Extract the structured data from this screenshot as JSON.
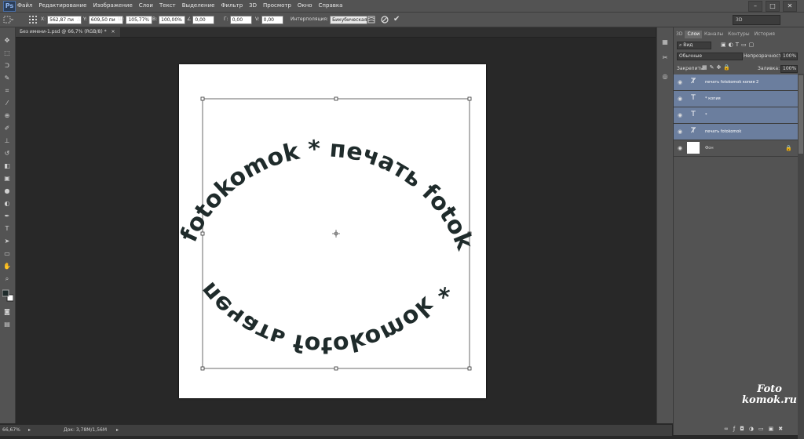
{
  "app": {
    "logo": "Ps"
  },
  "menu": {
    "items": [
      "Файл",
      "Редактирование",
      "Изображение",
      "Слои",
      "Текст",
      "Выделение",
      "Фильтр",
      "3D",
      "Просмотр",
      "Окно",
      "Справка"
    ],
    "win_min": "–",
    "win_max": "□",
    "win_close": "✕"
  },
  "options": {
    "x_label": "X:",
    "x_value": "562,87 пи",
    "y_label": "Y:",
    "y_value": "609,50 пи",
    "w_label": "Ш:",
    "w_value": "105,77%",
    "h_label": "В:",
    "h_value": "100,00%",
    "angle_value": "0,00",
    "hskew_label": "Г:",
    "hskew_value": "0,00",
    "vskew_label": "V:",
    "vskew_value": "0,00",
    "interp_label": "Интерполяция:",
    "interp_value": "Бикубическая",
    "workspace": "3D"
  },
  "document": {
    "tab_label": "Без имени-1.psd @ 66,7% (RGB/8) *",
    "close_glyph": "×",
    "circle_text_top": "печать fotokomok * печать fotokomok *",
    "circle_text_bottom": "печать fotokomok *"
  },
  "status": {
    "zoom": "66,67%",
    "doc_info": "Док: 3,78M/1,56M"
  },
  "panel": {
    "tabs": [
      "3D",
      "Слои",
      "Каналы",
      "Контуры",
      "История"
    ],
    "filter_label": "Вид",
    "blend_mode": "Обычные",
    "opacity_label": "Непрозрачность:",
    "opacity_value": "100%",
    "lock_label": "Закрепить:",
    "fill_label": "Заливка:",
    "fill_value": "100%",
    "layers": [
      {
        "name": "печать fotokomok копия 2",
        "kind": "warp",
        "selected": true
      },
      {
        "name": "* копия",
        "kind": "text",
        "selected": true
      },
      {
        "name": "*",
        "kind": "text",
        "selected": true
      },
      {
        "name": "печать fotokomok",
        "kind": "warp",
        "selected": true
      },
      {
        "name": "Фон",
        "kind": "background",
        "selected": false
      }
    ]
  },
  "watermark": {
    "line1": "Foto",
    "line2": "komok.ru"
  }
}
